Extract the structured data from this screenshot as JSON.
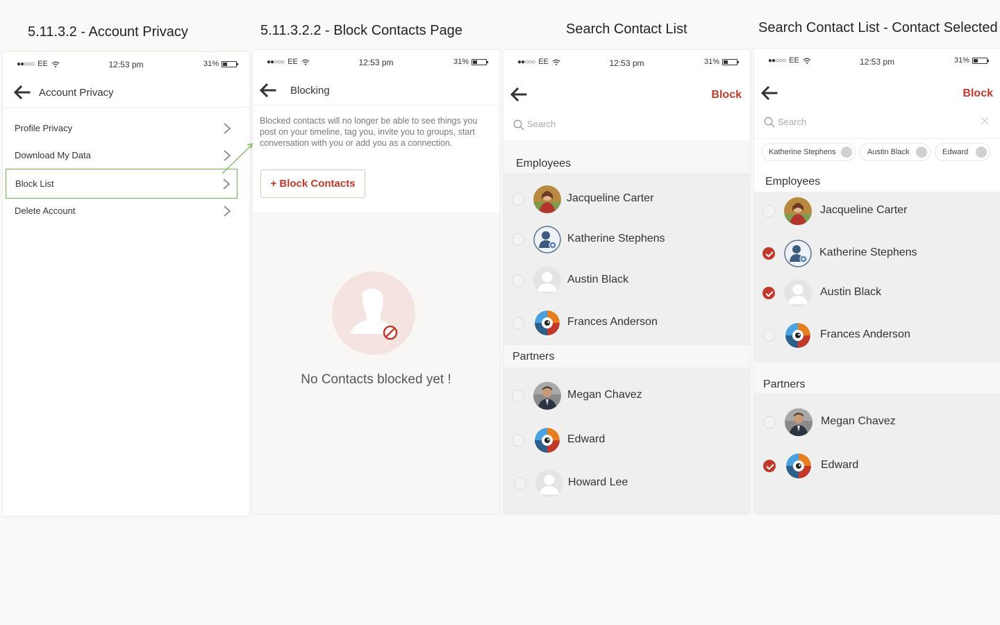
{
  "captions": [
    "5.11.3.2 - Account Privacy",
    "5.11.3.2.2 - Block Contacts Page",
    "Search Contact List",
    "Search Contact List - Contact Selected"
  ],
  "status": {
    "carrier": "EE",
    "time": "12:53 pm",
    "battery": "31%"
  },
  "panel1": {
    "title": "Account Privacy",
    "items": [
      {
        "label": "Profile Privacy"
      },
      {
        "label": "Download My Data"
      },
      {
        "label": "Block List"
      },
      {
        "label": "Delete Account"
      }
    ]
  },
  "panel2": {
    "title": "Blocking",
    "description": "Blocked contacts will no longer be able to see things you post on your timeline, tag you, invite you to groups, start conversation with you or add you as a connection.",
    "button": "+ Block Contacts",
    "empty_text": "No Contacts blocked yet !"
  },
  "panel3": {
    "action": "Block",
    "search_placeholder": "Search",
    "sections": [
      {
        "label": "Employees",
        "contacts": [
          "Jacqueline Carter",
          "Katherine Stephens",
          "Austin Black",
          "Frances Anderson"
        ]
      },
      {
        "label": "Partners",
        "contacts": [
          "Megan Chavez",
          "Edward",
          "Howard Lee"
        ]
      }
    ]
  },
  "panel4": {
    "action": "Block",
    "search_placeholder": "Search",
    "chips": [
      "Katherine Stephens",
      "Austin Black",
      "Edward"
    ],
    "sections": [
      {
        "label": "Employees",
        "contacts": [
          {
            "name": "Jacqueline Carter",
            "checked": false
          },
          {
            "name": "Katherine Stephens",
            "checked": true
          },
          {
            "name": "Austin Black",
            "checked": true
          },
          {
            "name": "Frances Anderson",
            "checked": false
          }
        ]
      },
      {
        "label": "Partners",
        "contacts": [
          {
            "name": "Megan Chavez",
            "checked": false
          },
          {
            "name": "Edward",
            "checked": true
          }
        ]
      }
    ]
  },
  "colors": {
    "accent": "#c0392b",
    "highlight": "#6ab04c"
  },
  "icons": [
    "back-arrow-icon",
    "chevron-right-icon",
    "search-icon",
    "close-icon",
    "block-user-icon",
    "wifi-icon",
    "battery-icon"
  ]
}
